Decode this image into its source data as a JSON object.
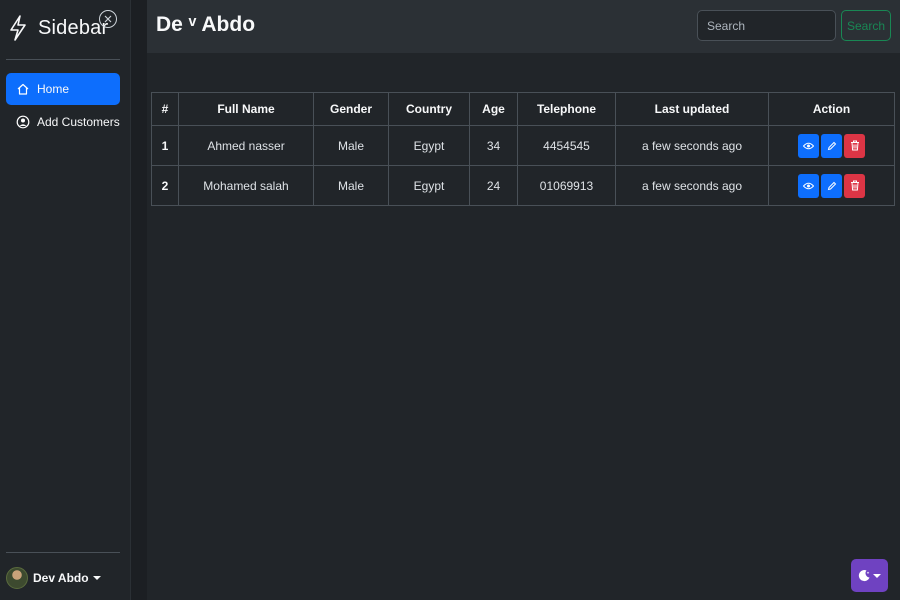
{
  "sidebar": {
    "title": "Sidebar",
    "items": [
      {
        "label": "Home",
        "icon": "home-icon",
        "active": true
      },
      {
        "label": "Add Customers",
        "icon": "user-circle-icon",
        "active": false
      }
    ],
    "user": {
      "name": "Dev Abdo"
    }
  },
  "header": {
    "title": "De ᵛ Abdo",
    "search": {
      "placeholder": "Search",
      "button_label": "Search"
    }
  },
  "table": {
    "columns": [
      "#",
      "Full Name",
      "Gender",
      "Country",
      "Age",
      "Telephone",
      "Last updated",
      "Action"
    ],
    "rows": [
      {
        "idx": "1",
        "name": "Ahmed nasser",
        "gender": "Male",
        "country": "Egypt",
        "age": "34",
        "phone": "4454545",
        "updated": "a few seconds ago"
      },
      {
        "idx": "2",
        "name": "Mohamed salah",
        "gender": "Male",
        "country": "Egypt",
        "age": "24",
        "phone": "01069913",
        "updated": "a few seconds ago"
      }
    ]
  },
  "colors": {
    "primary": "#0d6efd",
    "danger": "#dc3545",
    "success": "#198754",
    "purple": "#6f42c1",
    "bg": "#212529"
  }
}
